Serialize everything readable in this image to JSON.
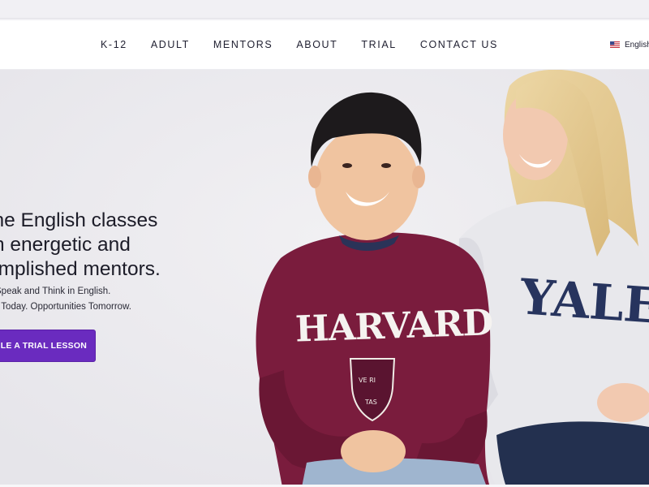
{
  "nav": {
    "items": [
      {
        "label": "K-12"
      },
      {
        "label": "ADULT"
      },
      {
        "label": "MENTORS"
      },
      {
        "label": "ABOUT"
      },
      {
        "label": "TRIAL"
      },
      {
        "label": "CONTACT US"
      }
    ],
    "language": {
      "label": "English",
      "icon": "us-flag-icon"
    }
  },
  "hero": {
    "title_lines": [
      "ine English classes",
      "n energetic and",
      "omplished mentors."
    ],
    "tagline_1": "Speak and Think in English.",
    "tagline_2": "w Today. Opportunities Tomorrow.",
    "cta_label": "DULE A TRIAL LESSON",
    "sweatshirt_text_left": "HARVARD",
    "sweatshirt_text_right": "YALE",
    "crest_text_top": "VE RI",
    "crest_text_bottom": "TAS"
  },
  "colors": {
    "accent": "#6a2bbf",
    "nav_background": "#ffffff",
    "hero_background": "#ecebef",
    "maroon": "#7a1c3d"
  }
}
